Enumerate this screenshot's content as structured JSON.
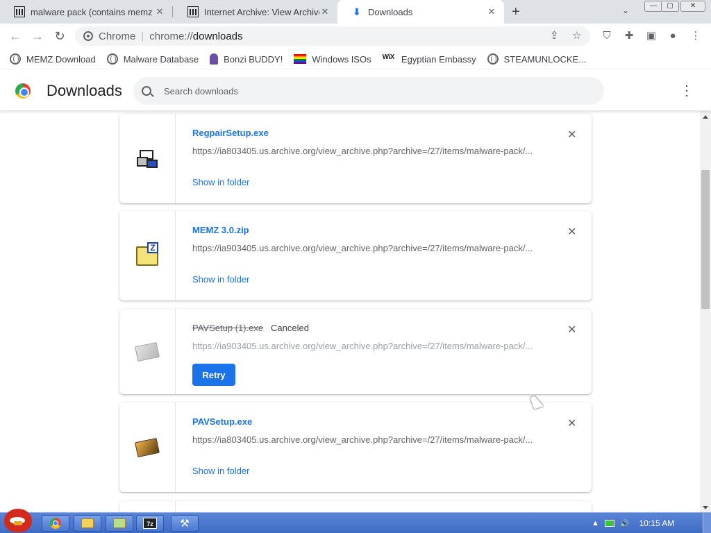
{
  "window": {
    "minimize": "—",
    "maximize": "▢",
    "close": "✕"
  },
  "tabs": [
    {
      "title": "malware pack (contains memz",
      "close": "✕"
    },
    {
      "title": "Internet Archive: View Archive",
      "close": "✕"
    },
    {
      "title": "Downloads",
      "close": "✕"
    }
  ],
  "newtab": "+",
  "tabsearch": "⌄",
  "omnibox": {
    "site": "Chrome",
    "url_prefix": "chrome://",
    "url_host": "downloads"
  },
  "bookmarks": [
    {
      "label": "MEMZ Download",
      "icon": "globe-icon"
    },
    {
      "label": "Malware Database",
      "icon": "globe-icon"
    },
    {
      "label": "Bonzi BUDDY!",
      "icon": "bonzi-icon"
    },
    {
      "label": "Windows ISOs",
      "icon": "rainbow-flag-icon"
    },
    {
      "label": "Egyptian Embassy",
      "icon": "wix-icon"
    },
    {
      "label": "STEAMUNLOCKE...",
      "icon": "globe-icon"
    }
  ],
  "downloads_page": {
    "title": "Downloads",
    "search_placeholder": "Search downloads",
    "items": [
      {
        "name": "RegpairSetup.exe",
        "url": "https://ia803405.us.archive.org/view_archive.php?archive=/27/items/malware-pack/...",
        "action": "Show in folder",
        "status": ""
      },
      {
        "name": "MEMZ 3.0.zip",
        "url": "https://ia903405.us.archive.org/view_archive.php?archive=/27/items/malware-pack/...",
        "action": "Show in folder",
        "status": ""
      },
      {
        "name": "PAVSetup (1).exe",
        "url": "https://ia903405.us.archive.org/view_archive.php?archive=/27/items/malware-pack/...",
        "action": "Retry",
        "status": "Canceled"
      },
      {
        "name": "PAVSetup.exe",
        "url": "https://ia803405.us.archive.org/view_archive.php?archive=/27/items/malware-pack/...",
        "action": "Show in folder",
        "status": ""
      }
    ]
  },
  "taskbar": {
    "clock": "10:15 AM",
    "tb_7z": "7z"
  },
  "colors": {
    "accent": "#1a73e8",
    "taskbar": "#4a78d0",
    "tabstrip": "#dee1e6"
  }
}
